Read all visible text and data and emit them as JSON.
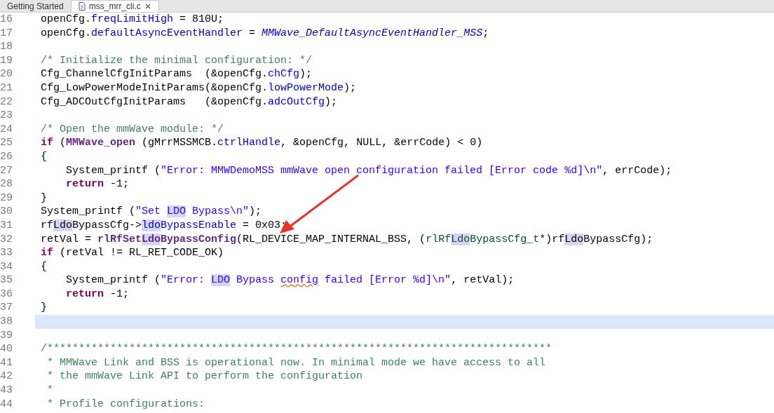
{
  "tabs": [
    {
      "label": "Getting Started",
      "selected": false,
      "closable": false
    },
    {
      "label": "mss_mrr_cli.c",
      "selected": true,
      "closable": true
    }
  ],
  "lines": [
    {
      "number": "16",
      "current": false,
      "tokens": [
        {
          "text": "openCfg.",
          "kind": "plain",
          "highlighted": false,
          "misspelled": false
        },
        {
          "text": "freqLimitHigh",
          "kind": "field",
          "highlighted": false,
          "misspelled": false
        },
        {
          "text": " = 810U;",
          "kind": "plain",
          "highlighted": false,
          "misspelled": false
        }
      ]
    },
    {
      "number": "17",
      "current": false,
      "tokens": [
        {
          "text": "openCfg.",
          "kind": "plain",
          "highlighted": false,
          "misspelled": false
        },
        {
          "text": "defaultAsyncEventHandler",
          "kind": "field",
          "highlighted": false,
          "misspelled": false
        },
        {
          "text": " = ",
          "kind": "plain",
          "highlighted": false,
          "misspelled": false
        },
        {
          "text": "MMWave_DefaultAsyncEventHandler_MSS",
          "kind": "italic",
          "highlighted": false,
          "misspelled": false
        },
        {
          "text": ";",
          "kind": "plain",
          "highlighted": false,
          "misspelled": false
        }
      ]
    },
    {
      "number": "18",
      "current": false
    },
    {
      "number": "19",
      "current": false,
      "tokens": [
        {
          "text": "/* Initialize the minimal configuration: */",
          "kind": "comment",
          "highlighted": false,
          "misspelled": false
        }
      ]
    },
    {
      "number": "20",
      "current": false,
      "tokens": [
        {
          "text": "Cfg_ChannelCfgInitParams  (&openCfg.",
          "kind": "plain",
          "highlighted": false,
          "misspelled": false
        },
        {
          "text": "chCfg",
          "kind": "field",
          "highlighted": false,
          "misspelled": false
        },
        {
          "text": ");",
          "kind": "plain",
          "highlighted": false,
          "misspelled": false
        }
      ]
    },
    {
      "number": "21",
      "current": false,
      "tokens": [
        {
          "text": "Cfg_LowPowerModeInitParams(&openCfg.",
          "kind": "plain",
          "highlighted": false,
          "misspelled": false
        },
        {
          "text": "lowPowerMode",
          "kind": "field",
          "highlighted": false,
          "misspelled": false
        },
        {
          "text": ");",
          "kind": "plain",
          "highlighted": false,
          "misspelled": false
        }
      ]
    },
    {
      "number": "22",
      "current": false,
      "tokens": [
        {
          "text": "Cfg_ADCOutCfgInitParams   (&openCfg.",
          "kind": "plain",
          "highlighted": false,
          "misspelled": false
        },
        {
          "text": "adcOutCfg",
          "kind": "field",
          "highlighted": false,
          "misspelled": false
        },
        {
          "text": ");",
          "kind": "plain",
          "highlighted": false,
          "misspelled": false
        }
      ]
    },
    {
      "number": "23",
      "current": false
    },
    {
      "number": "24",
      "current": false,
      "tokens": [
        {
          "text": "/* Open the mmWave module: */",
          "kind": "comment",
          "highlighted": false,
          "misspelled": false
        }
      ]
    },
    {
      "number": "25",
      "current": false,
      "tokens": [
        {
          "text": "if",
          "kind": "keyword",
          "highlighted": false,
          "misspelled": false
        },
        {
          "text": " (",
          "kind": "plain",
          "highlighted": false,
          "misspelled": false
        },
        {
          "text": "MMWave_open",
          "kind": "call",
          "highlighted": false,
          "misspelled": false
        },
        {
          "text": " (gMrrMSSMCB.",
          "kind": "plain",
          "highlighted": false,
          "misspelled": false
        },
        {
          "text": "ctrlHandle",
          "kind": "field",
          "highlighted": false,
          "misspelled": false
        },
        {
          "text": ", &openCfg, NULL, &errCode) < 0)",
          "kind": "plain",
          "highlighted": false,
          "misspelled": false
        }
      ]
    },
    {
      "number": "26",
      "current": false,
      "tokens": [
        {
          "text": "{",
          "kind": "plain",
          "highlighted": false,
          "misspelled": false
        }
      ]
    },
    {
      "number": "27",
      "current": false,
      "tokens": [
        {
          "text": "    System_printf (",
          "kind": "plain",
          "highlighted": false,
          "misspelled": false
        },
        {
          "text": "\"Error: MMWDemoMSS mmWave open configuration failed [Error code %d]\\n\"",
          "kind": "string",
          "highlighted": false,
          "misspelled": false
        },
        {
          "text": ", errCode);",
          "kind": "plain",
          "highlighted": false,
          "misspelled": false
        }
      ]
    },
    {
      "number": "28",
      "current": false,
      "tokens": [
        {
          "text": "    return",
          "kind": "keyword",
          "highlighted": false,
          "misspelled": false
        },
        {
          "text": " -1;",
          "kind": "plain",
          "highlighted": false,
          "misspelled": false
        }
      ]
    },
    {
      "number": "29",
      "current": false,
      "tokens": [
        {
          "text": "}",
          "kind": "plain",
          "highlighted": false,
          "misspelled": false
        }
      ]
    },
    {
      "number": "30",
      "current": false,
      "tokens": [
        {
          "text": "System_printf (",
          "kind": "plain",
          "highlighted": false,
          "misspelled": false
        },
        {
          "text": "\"Set ",
          "kind": "string",
          "highlighted": false,
          "misspelled": false
        },
        {
          "text": "LDO",
          "kind": "string",
          "highlighted": true,
          "misspelled": false
        },
        {
          "text": " Bypass\\n\"",
          "kind": "string",
          "highlighted": false,
          "misspelled": false
        },
        {
          "text": ");",
          "kind": "plain",
          "highlighted": false,
          "misspelled": false
        }
      ]
    },
    {
      "number": "31",
      "current": false,
      "tokens": [
        {
          "text": "rf",
          "kind": "plain",
          "highlighted": false,
          "misspelled": false
        },
        {
          "text": "Ldo",
          "kind": "plain",
          "highlighted": true,
          "misspelled": false
        },
        {
          "text": "BypassCfg->",
          "kind": "plain",
          "highlighted": false,
          "misspelled": false
        },
        {
          "text": "ldo",
          "kind": "field",
          "highlighted": true,
          "misspelled": false
        },
        {
          "text": "BypassEnable",
          "kind": "field",
          "highlighted": false,
          "misspelled": false
        },
        {
          "text": " = 0x03;",
          "kind": "plain",
          "highlighted": false,
          "misspelled": false
        }
      ]
    },
    {
      "number": "32",
      "current": false,
      "tokens": [
        {
          "text": "retVal = ",
          "kind": "plain",
          "highlighted": false,
          "misspelled": false
        },
        {
          "text": "rlRfSet",
          "kind": "call",
          "highlighted": false,
          "misspelled": false
        },
        {
          "text": "Ldo",
          "kind": "call",
          "highlighted": true,
          "misspelled": false
        },
        {
          "text": "BypassConfig",
          "kind": "call",
          "highlighted": false,
          "misspelled": false
        },
        {
          "text": "(RL_DEVICE_MAP_INTERNAL_BSS, (",
          "kind": "plain",
          "highlighted": false,
          "misspelled": false
        },
        {
          "text": "rlRf",
          "kind": "type",
          "highlighted": false,
          "misspelled": false
        },
        {
          "text": "Ldo",
          "kind": "type",
          "highlighted": true,
          "misspelled": false
        },
        {
          "text": "BypassCfg_t",
          "kind": "type",
          "highlighted": false,
          "misspelled": false
        },
        {
          "text": "*)rf",
          "kind": "plain",
          "highlighted": false,
          "misspelled": false
        },
        {
          "text": "Ldo",
          "kind": "plain",
          "highlighted": true,
          "misspelled": false
        },
        {
          "text": "BypassCfg);",
          "kind": "plain",
          "highlighted": false,
          "misspelled": false
        }
      ]
    },
    {
      "number": "33",
      "current": false,
      "tokens": [
        {
          "text": "if",
          "kind": "keyword",
          "highlighted": false,
          "misspelled": false
        },
        {
          "text": " (retVal != RL_RET_CODE_OK)",
          "kind": "plain",
          "highlighted": false,
          "misspelled": false
        }
      ]
    },
    {
      "number": "34",
      "current": false,
      "tokens": [
        {
          "text": "{",
          "kind": "plain",
          "highlighted": false,
          "misspelled": false
        }
      ]
    },
    {
      "number": "35",
      "current": false,
      "tokens": [
        {
          "text": "    System_printf (",
          "kind": "plain",
          "highlighted": false,
          "misspelled": false
        },
        {
          "text": "\"Error: ",
          "kind": "string",
          "highlighted": false,
          "misspelled": false
        },
        {
          "text": "LDO",
          "kind": "string",
          "highlighted": true,
          "misspelled": false
        },
        {
          "text": " Bypass ",
          "kind": "string",
          "highlighted": false,
          "misspelled": false
        },
        {
          "text": "config",
          "kind": "string",
          "highlighted": false,
          "misspelled": true
        },
        {
          "text": " failed [Error %d]\\n\"",
          "kind": "string",
          "highlighted": false,
          "misspelled": false
        },
        {
          "text": ", retVal);",
          "kind": "plain",
          "highlighted": false,
          "misspelled": false
        }
      ]
    },
    {
      "number": "36",
      "current": false,
      "tokens": [
        {
          "text": "    return",
          "kind": "keyword",
          "highlighted": false,
          "misspelled": false
        },
        {
          "text": " -1;",
          "kind": "plain",
          "highlighted": false,
          "misspelled": false
        }
      ]
    },
    {
      "number": "37",
      "current": false,
      "tokens": [
        {
          "text": "}",
          "kind": "plain",
          "highlighted": false,
          "misspelled": false
        }
      ]
    },
    {
      "number": "38",
      "current": true
    },
    {
      "number": "39",
      "current": false
    },
    {
      "number": "40",
      "current": false,
      "tokens": [
        {
          "text": "/********************************************************************************",
          "kind": "comment",
          "highlighted": false,
          "misspelled": false
        }
      ]
    },
    {
      "number": "41",
      "current": false,
      "tokens": [
        {
          "text": " * MMWave Link and BSS is operational now. In minimal mode we have access to all",
          "kind": "comment",
          "highlighted": false,
          "misspelled": false
        }
      ]
    },
    {
      "number": "42",
      "current": false,
      "tokens": [
        {
          "text": " * the mmWave Link API to perform the configuration",
          "kind": "comment",
          "highlighted": false,
          "misspelled": false
        }
      ]
    },
    {
      "number": "43",
      "current": false,
      "tokens": [
        {
          "text": " *",
          "kind": "comment",
          "highlighted": false,
          "misspelled": false
        }
      ]
    },
    {
      "number": "44",
      "current": false,
      "tokens": [
        {
          "text": " * Profile configurations:",
          "kind": "comment",
          "highlighted": false,
          "misspelled": false
        }
      ]
    }
  ]
}
